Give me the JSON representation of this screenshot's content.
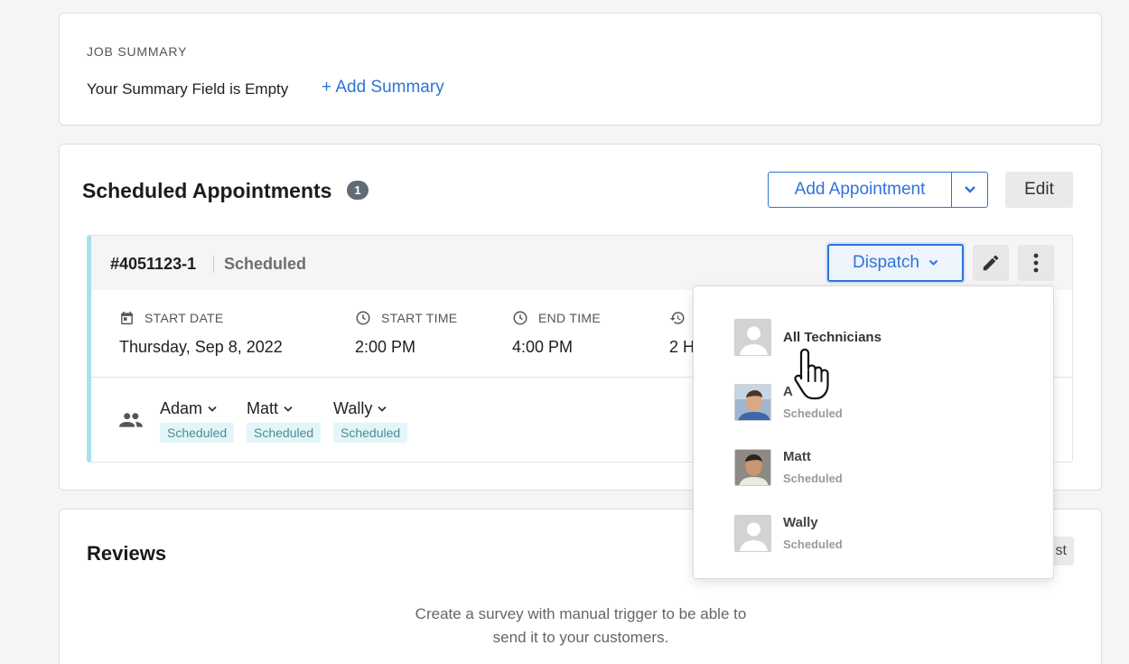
{
  "job_summary": {
    "heading": "JOB SUMMARY",
    "empty_text": "Your Summary Field is Empty",
    "add_link": "+ Add Summary"
  },
  "appointments": {
    "title": "Scheduled Appointments",
    "count": "1",
    "add_button": "Add Appointment",
    "edit_button": "Edit",
    "appointment": {
      "id": "#4051123-1",
      "status": "Scheduled",
      "dispatch_button": "Dispatch",
      "fields": [
        {
          "label": "START DATE",
          "value": "Thursday, Sep 8, 2022",
          "icon": "calendar-icon"
        },
        {
          "label": "START TIME",
          "value": "2:00 PM",
          "icon": "clock-icon"
        },
        {
          "label": "END TIME",
          "value": "4:00 PM",
          "icon": "clock-icon"
        },
        {
          "label": "",
          "value": "2 H",
          "icon": "history-icon"
        }
      ],
      "technicians": [
        {
          "name": "Adam",
          "status": "Scheduled"
        },
        {
          "name": "Matt",
          "status": "Scheduled"
        },
        {
          "name": "Wally",
          "status": "Scheduled"
        }
      ]
    }
  },
  "dispatch_menu": {
    "items": [
      {
        "name": "All Technicians",
        "status": "",
        "avatar": "placeholder"
      },
      {
        "name": "A",
        "status": "Scheduled",
        "avatar": "photo"
      },
      {
        "name": "Matt",
        "status": "Scheduled",
        "avatar": "photo"
      },
      {
        "name": "Wally",
        "status": "Scheduled",
        "avatar": "placeholder"
      }
    ]
  },
  "reviews": {
    "title": "Reviews",
    "side_button_partial": "st",
    "message_line1": "Create a survey with manual trigger to be able to",
    "message_line2": "send it to your customers."
  },
  "colors": {
    "accent": "#2f73d9",
    "status_bg": "#e2f6f9",
    "row_border": "#a8e1ec"
  }
}
